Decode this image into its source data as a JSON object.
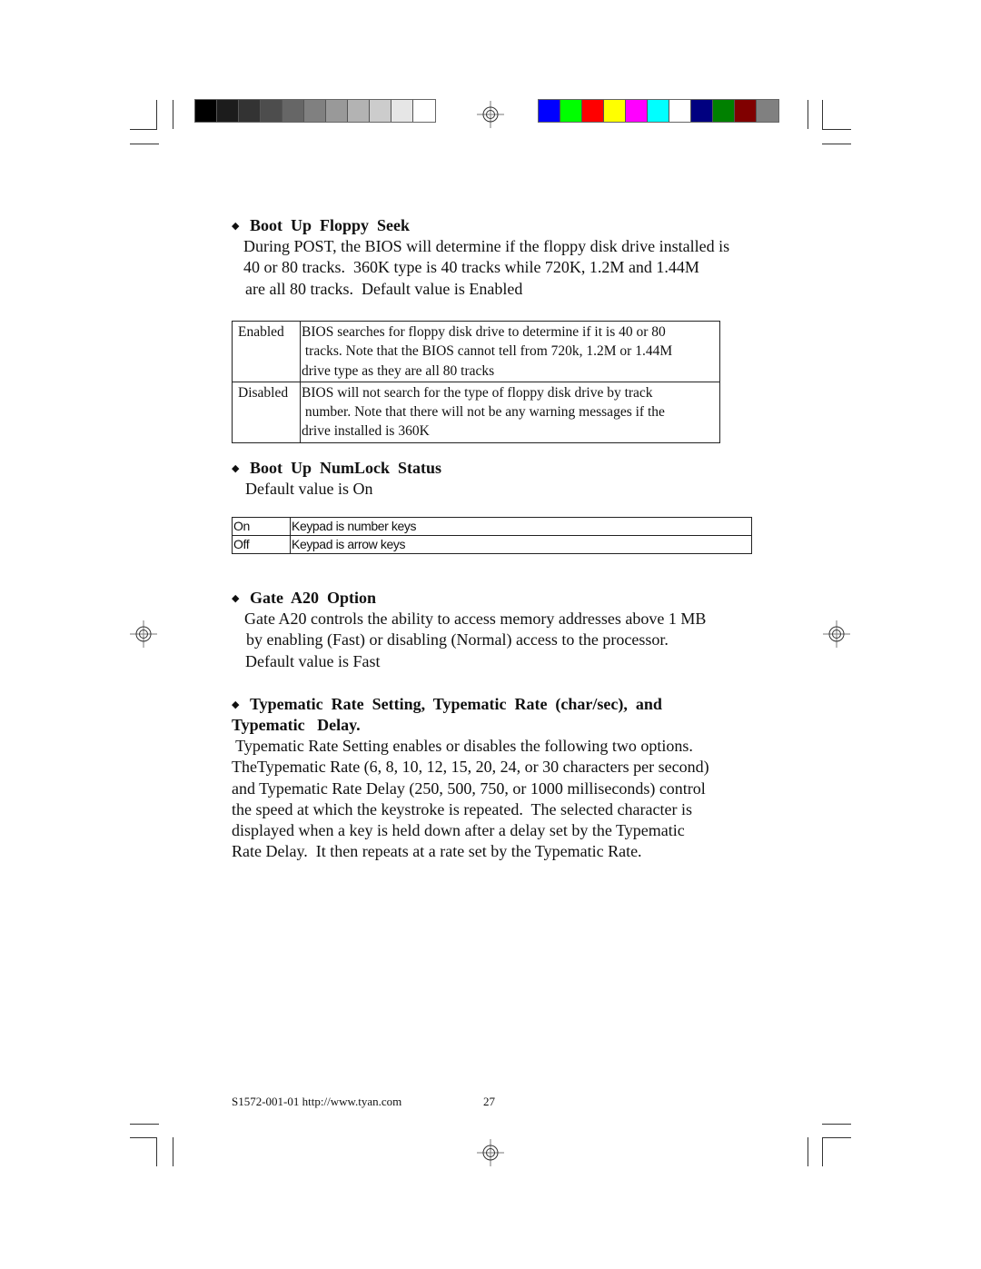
{
  "print_marks": {
    "grayscale_bar": [
      "#000000",
      "#1c1c1c",
      "#333333",
      "#4d4d4d",
      "#666666",
      "#808080",
      "#999999",
      "#b3b3b3",
      "#cccccc",
      "#e6e6e6",
      "#ffffff"
    ],
    "color_bar": [
      "#0000ff",
      "#00ff00",
      "#ff0000",
      "#ffff00",
      "#ff00ff",
      "#00ffff",
      "#ffffff",
      "#000080",
      "#008000",
      "#800000",
      "#808080"
    ]
  },
  "sections": {
    "floppy_seek": {
      "bullet": "◆",
      "title": "Boot  Up  Floppy  Seek",
      "lines": [
        "During POST, the BIOS will determine if the floppy disk drive installed is",
        "40 or 80 tracks.  360K type is 40 tracks while 720K, 1.2M and 1.44M",
        "are all 80 tracks.  Default value is Enabled"
      ],
      "table": [
        {
          "option": "Enabled",
          "lines": [
            "BIOS searches for floppy disk drive to determine if it is 40 or 80",
            " tracks. Note that the BIOS cannot tell from 720k, 1.2M or 1.44M",
            "drive type as they are all 80 tracks"
          ]
        },
        {
          "option": "Disabled",
          "lines": [
            "BIOS will not search for the type of floppy disk drive by track",
            " number. Note that there will not be any warning messages if the",
            "drive installed is 360K"
          ]
        }
      ]
    },
    "numlock": {
      "bullet": "◆",
      "title": "Boot  Up  NumLock  Status",
      "lines": [
        "Default value is On"
      ],
      "table": [
        {
          "option": "On",
          "description": "Keypad is number keys"
        },
        {
          "option": "Off",
          "description": "Keypad is arrow keys"
        }
      ]
    },
    "gate_a20": {
      "bullet": "◆",
      "title": "Gate  A20  Option",
      "lines": [
        "Gate A20 controls the ability to access memory addresses above 1 MB",
        "by enabling (Fast) or disabling (Normal) access to the processor.",
        "Default value is Fast"
      ]
    },
    "typematic": {
      "bullet": "◆",
      "title_line1": "Typematic  Rate  Setting,  Typematic  Rate  (char/sec),  and",
      "title_line2": "Typematic   Delay.",
      "lines": [
        " Typematic Rate Setting enables or disables the following two options.",
        "TheTypematic Rate (6, 8, 10, 12, 15, 20, 24, or 30 characters per second)",
        "and Typematic Rate Delay (250, 500, 750, or 1000 milliseconds) control",
        "the speed at which the keystroke is repeated.  The selected character is",
        "displayed when a key is held down after a delay set by the Typematic",
        "Rate Delay.  It then repeats at a rate set by the Typematic Rate."
      ]
    }
  },
  "footer": {
    "doc_id": "S1572-001-01",
    "url": "http://www.tyan.com",
    "page_number": "27"
  }
}
